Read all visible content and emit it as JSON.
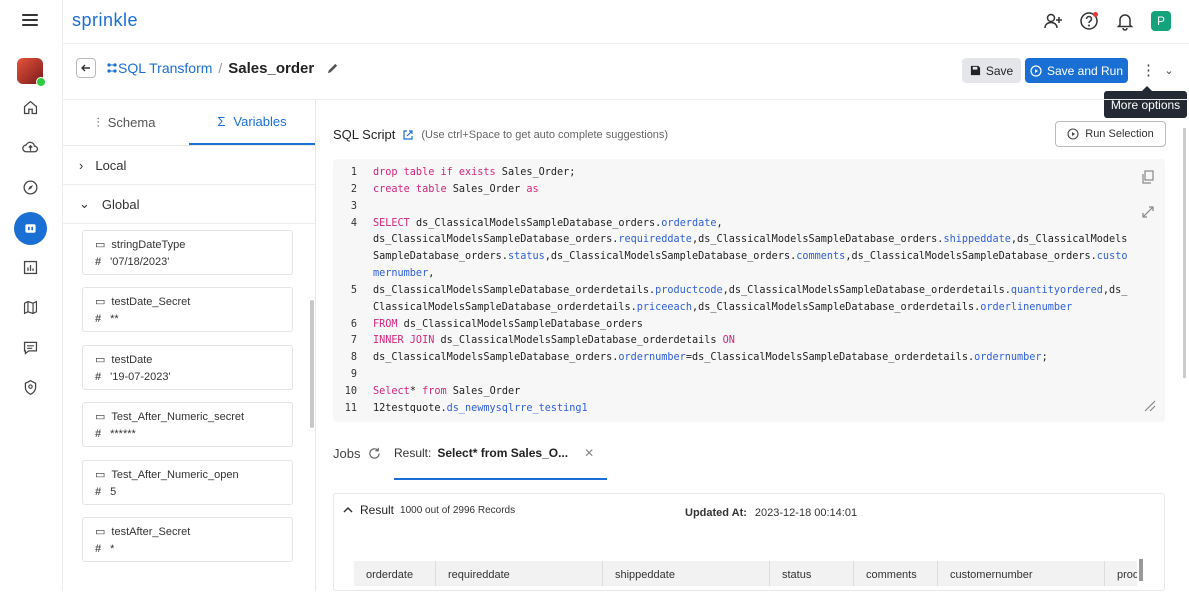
{
  "brand": "sprinkle",
  "user_initial": "P",
  "breadcrumb": {
    "parent": "SQL Transform",
    "separator": "/",
    "current": "Sales_order"
  },
  "toolbar": {
    "save": "Save",
    "save_run": "Save and Run",
    "tooltip": "More options"
  },
  "left_tabs": {
    "schema": "Schema",
    "variables": "Variables"
  },
  "tree": {
    "local": "Local",
    "global": "Global"
  },
  "variables": [
    {
      "name": "stringDateType",
      "value": "'07/18/2023'"
    },
    {
      "name": "testDate_Secret",
      "value": "**"
    },
    {
      "name": "testDate",
      "value": "'19-07-2023'"
    },
    {
      "name": "Test_After_Numeric_secret",
      "value": "******"
    },
    {
      "name": "Test_After_Numeric_open",
      "value": "5"
    },
    {
      "name": "testAfter_Secret",
      "value": "*"
    }
  ],
  "sql": {
    "title": "SQL Script",
    "hint": "(Use ctrl+Space to get auto complete suggestions)",
    "run_selection": "Run Selection"
  },
  "code_numbers": [
    "1",
    "2",
    "3",
    "4",
    "5",
    "6",
    "7",
    "8",
    "9",
    "10",
    "11"
  ],
  "jobs_label": "Jobs",
  "result_tab": {
    "label": "Result:",
    "name": "Select* from Sales_O..."
  },
  "result": {
    "title": "Result",
    "count": "1000 out of 2996 Records",
    "updated_label": "Updated At:",
    "updated_value": "2023-12-18 00:14:01"
  },
  "columns": [
    "orderdate",
    "requireddate",
    "shippeddate",
    "status",
    "comments",
    "customernumber",
    "prod"
  ],
  "colors": {
    "accent": "#1a6fd4",
    "keyword": "#d4247c",
    "property": "#2f5fd8"
  }
}
